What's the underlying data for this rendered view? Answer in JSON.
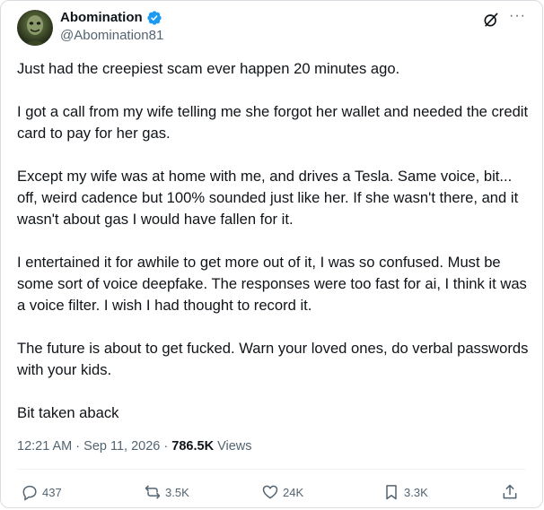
{
  "author": {
    "display_name": "Abomination",
    "handle": "@Abomination81",
    "avatar_icon": "zombie-avatar",
    "verified_color": "#1d9bf0"
  },
  "header_icons": {
    "grok": "grok-icon",
    "more": "···"
  },
  "tweet": {
    "paragraphs": [
      "Just had the creepiest scam ever happen 20 minutes ago.",
      "I got a call from my wife telling me she forgot her wallet and needed the credit card to pay for her gas.",
      "Except my wife was at home with me, and drives a Tesla.  Same voice, bit... off, weird cadence but 100% sounded just like her.  If she wasn't there, and it wasn't about gas I would have fallen for it.",
      "I entertained it for awhile to get more out of it, I was so confused.  Must be some sort of voice deepfake.   The responses were too fast for ai, I think it was a voice filter.  I wish I had thought to record it.",
      "The future is about to get fucked.  Warn your loved ones, do verbal passwords with your kids.",
      "Bit taken aback"
    ]
  },
  "meta": {
    "time": "12:21 AM",
    "separator": "·",
    "date": "Sep 11, 2026",
    "views_count": "786.5K",
    "views_label": "Views"
  },
  "actions": {
    "replies": "437",
    "reposts": "3.5K",
    "likes": "24K",
    "bookmarks": "3.3K"
  },
  "colors": {
    "text": "#0f1419",
    "secondary": "#536471",
    "border": "#d9dde1"
  }
}
